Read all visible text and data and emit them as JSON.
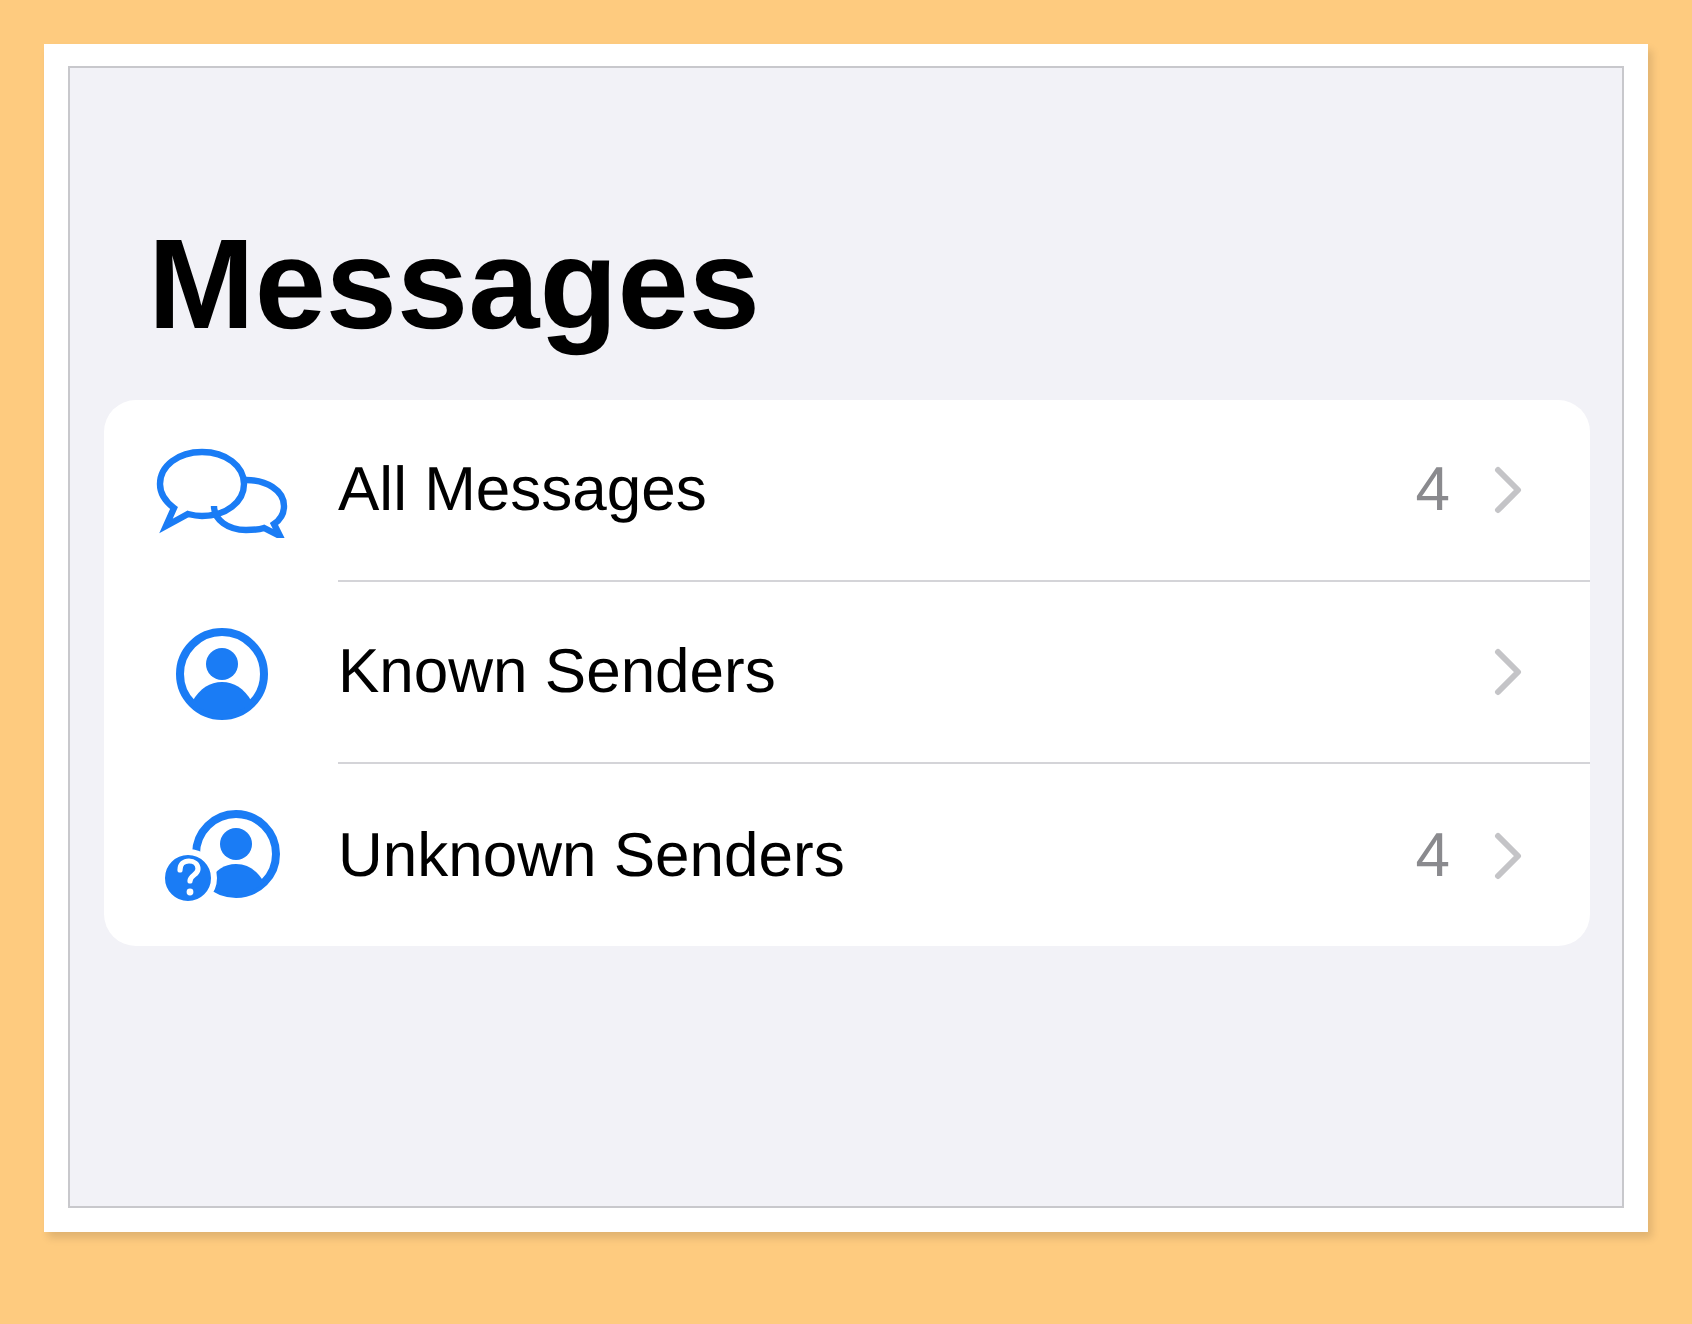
{
  "title": "Messages",
  "rows": [
    {
      "kind": "chat",
      "label": "All Messages",
      "count": "4"
    },
    {
      "kind": "person",
      "label": "Known Senders"
    },
    {
      "kind": "unknown",
      "label": "Unknown Senders",
      "count": "4"
    }
  ]
}
